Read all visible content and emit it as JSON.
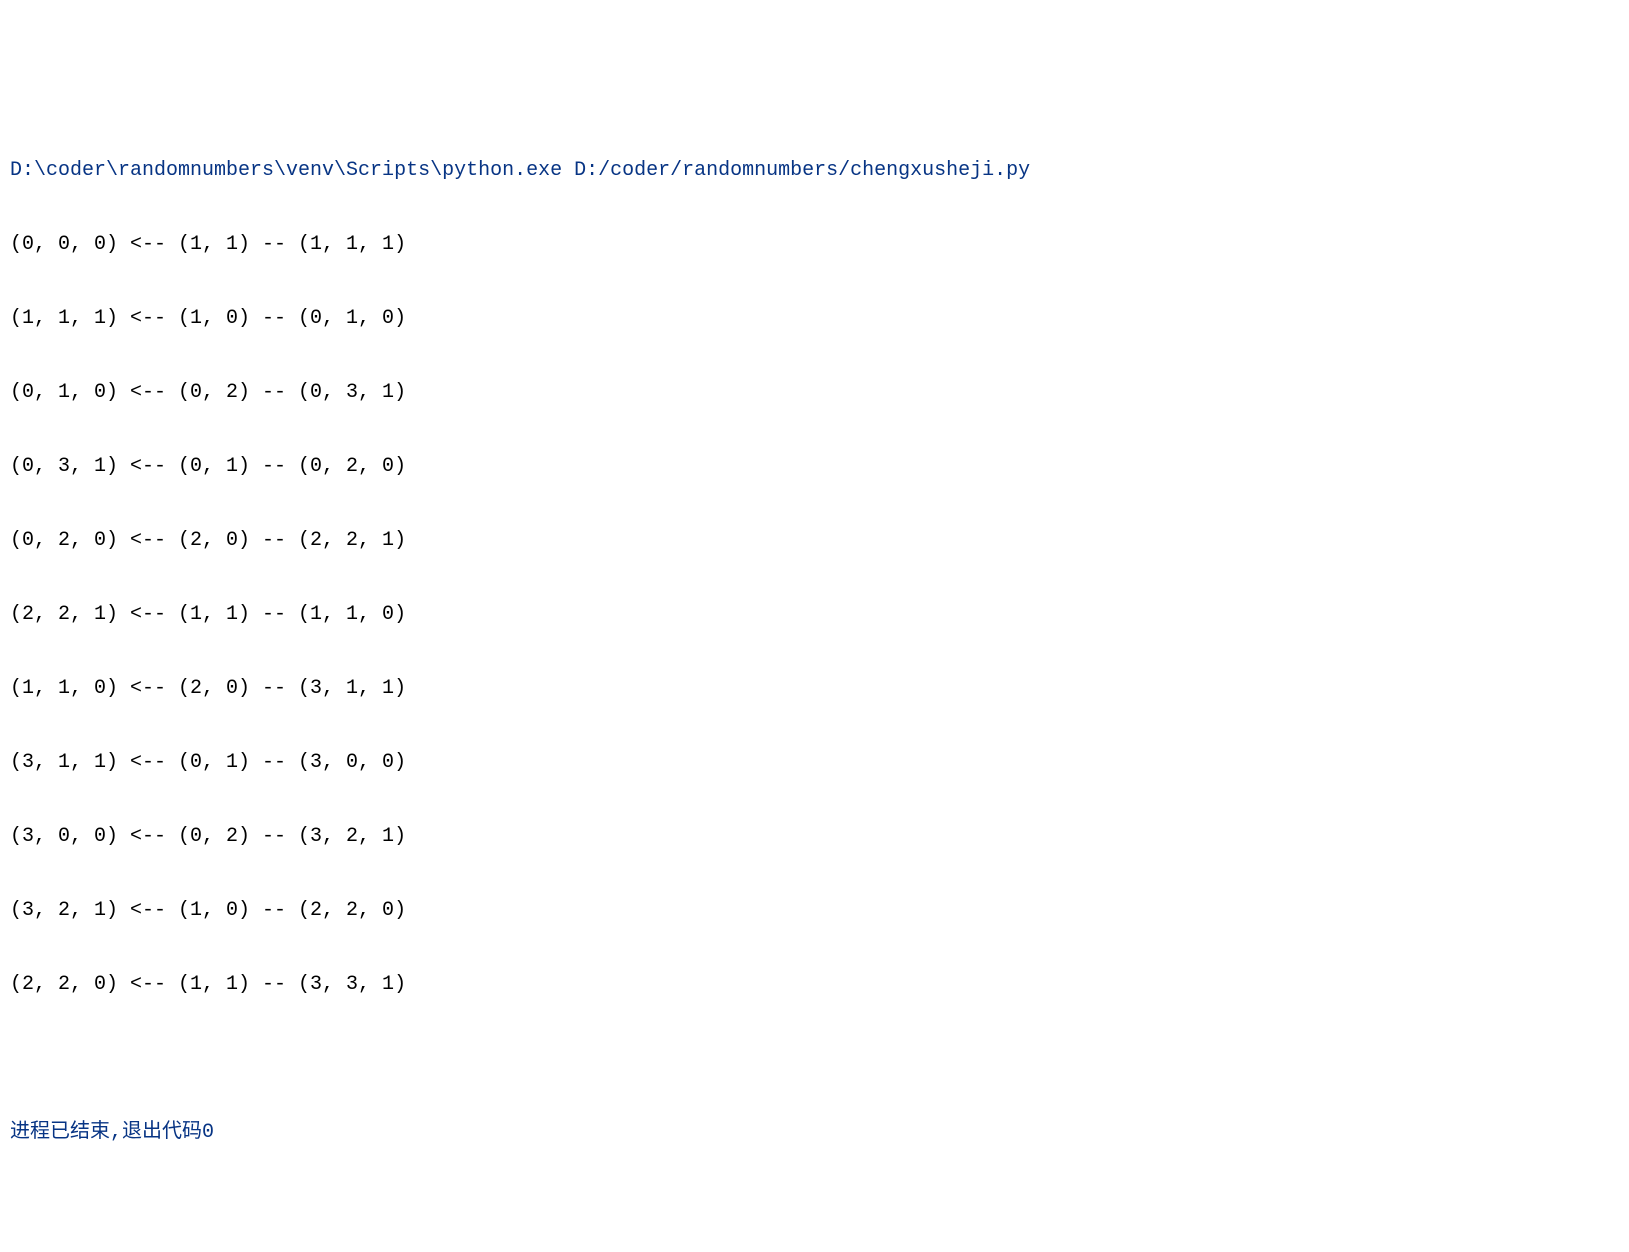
{
  "console": {
    "command": "D:\\coder\\randomnumbers\\venv\\Scripts\\python.exe D:/coder/randomnumbers/chengxusheji.py",
    "output_lines": [
      "(0, 0, 0) <-- (1, 1) -- (1, 1, 1)",
      "(1, 1, 1) <-- (1, 0) -- (0, 1, 0)",
      "(0, 1, 0) <-- (0, 2) -- (0, 3, 1)",
      "(0, 3, 1) <-- (0, 1) -- (0, 2, 0)",
      "(0, 2, 0) <-- (2, 0) -- (2, 2, 1)",
      "(2, 2, 1) <-- (1, 1) -- (1, 1, 0)",
      "(1, 1, 0) <-- (2, 0) -- (3, 1, 1)",
      "(3, 1, 1) <-- (0, 1) -- (3, 0, 0)",
      "(3, 0, 0) <-- (0, 2) -- (3, 2, 1)",
      "(3, 2, 1) <-- (1, 0) -- (2, 2, 0)",
      "(2, 2, 0) <-- (1, 1) -- (3, 3, 1)"
    ],
    "exit_message": "进程已结束,退出代码0"
  }
}
